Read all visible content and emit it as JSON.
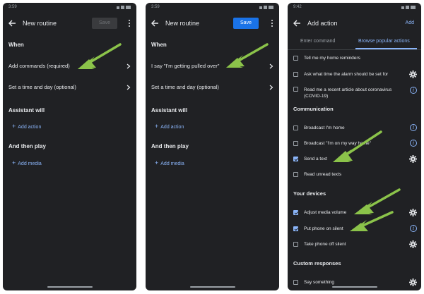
{
  "status": {
    "time_left": "3:59",
    "time_middle": "3:59",
    "time_right": "9:42"
  },
  "screen1": {
    "title": "New routine",
    "save_label": "Save",
    "when_header": "When",
    "add_commands_label": "Add commands (required)",
    "time_day_label": "Set a time and day (optional)",
    "assistant_header": "Assistant will",
    "add_action_label": "Add action",
    "then_play_header": "And then play",
    "add_media_label": "Add media"
  },
  "screen2": {
    "title": "New routine",
    "save_label": "Save",
    "when_header": "When",
    "command_label": "I say \"I'm getting pulled over\"",
    "time_day_label": "Set a time and day (optional)",
    "assistant_header": "Assistant will",
    "add_action_label": "Add action",
    "then_play_header": "And then play",
    "add_media_label": "Add media"
  },
  "screen3": {
    "title": "Add action",
    "add_label": "Add",
    "tabs": [
      "Enter command",
      "Browse popular actions"
    ],
    "items_top": [
      {
        "label": "Tell me my home reminders",
        "checked": false,
        "icon": ""
      },
      {
        "label": "Ask what time the alarm should be set for",
        "checked": false,
        "icon": "gear-icon"
      },
      {
        "label": "Read me a recent article about coronavirus (COVID-19)",
        "checked": false,
        "icon": "info-icon"
      }
    ],
    "communication_header": "Communication",
    "communication_items": [
      {
        "label": "Broadcast I'm home",
        "checked": false,
        "icon": "info-icon"
      },
      {
        "label": "Broadcast \"I'm on my way home\"",
        "checked": false,
        "icon": "info-icon"
      },
      {
        "label": "Send a text",
        "checked": true,
        "icon": "gear-icon"
      },
      {
        "label": "Read unread texts",
        "checked": false,
        "icon": ""
      }
    ],
    "devices_header": "Your devices",
    "devices_items": [
      {
        "label": "Adjust media volume",
        "checked": true,
        "icon": "gear-icon"
      },
      {
        "label": "Put phone on silent",
        "checked": true,
        "icon": "info-icon"
      },
      {
        "label": "Take phone off silent",
        "checked": false,
        "icon": "gear-icon"
      }
    ],
    "custom_header": "Custom responses",
    "custom_items": [
      {
        "label": "Say something",
        "checked": false,
        "icon": "gear-icon"
      }
    ]
  },
  "colors": {
    "background": "#202124",
    "accent": "#8ab4f8",
    "save_button": "#1a73e8",
    "arrow": "#8bc34a"
  }
}
